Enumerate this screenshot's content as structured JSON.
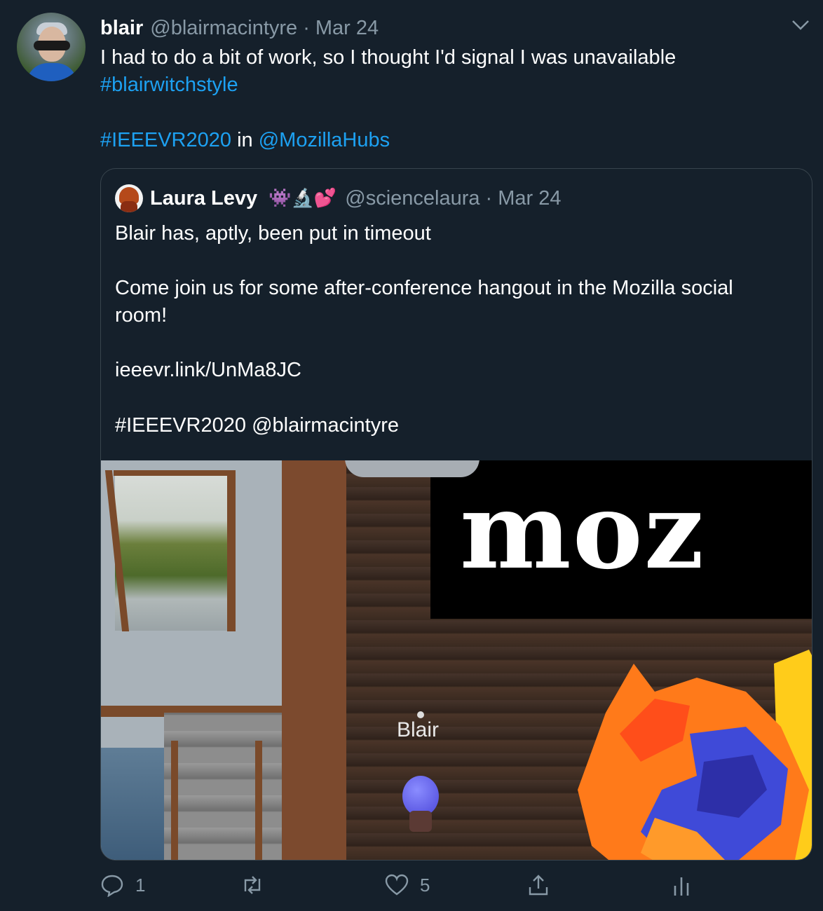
{
  "tweet": {
    "author_name": "blair",
    "author_handle": "@blairmacintyre",
    "separator": "·",
    "date": "Mar 24",
    "text_line1": "I had to do a bit of work, so I thought I'd signal I was unavailable",
    "hashtag1": "#blairwitchstyle",
    "hashtag2": "#IEEEVR2020",
    "in_word": "in",
    "mention": "@MozillaHubs"
  },
  "quoted": {
    "author_name": "Laura Levy",
    "emojis": "👾🔬💕",
    "author_handle": "@sciencelaura",
    "separator": "·",
    "date": "Mar 24",
    "line1": "Blair has, aptly, been put in timeout",
    "line2a": "Come join us for some after-conference hangout in the Mozilla social",
    "line2b": "room!",
    "link": "ieeevr.link/UnMa8JC",
    "tags": "#IEEEVR2020 @blairmacintyre",
    "media": {
      "sign_text": "moz",
      "avatar_label": "Blair"
    }
  },
  "actions": {
    "reply_count": "1",
    "retweet_count": "",
    "like_count": "5"
  },
  "colors": {
    "background": "#15202b",
    "link": "#1da1f2",
    "muted": "#8899a6",
    "border": "#38444d"
  },
  "icons": [
    "chevron-down-icon",
    "reply-icon",
    "retweet-icon",
    "like-icon",
    "share-icon",
    "analytics-icon"
  ]
}
